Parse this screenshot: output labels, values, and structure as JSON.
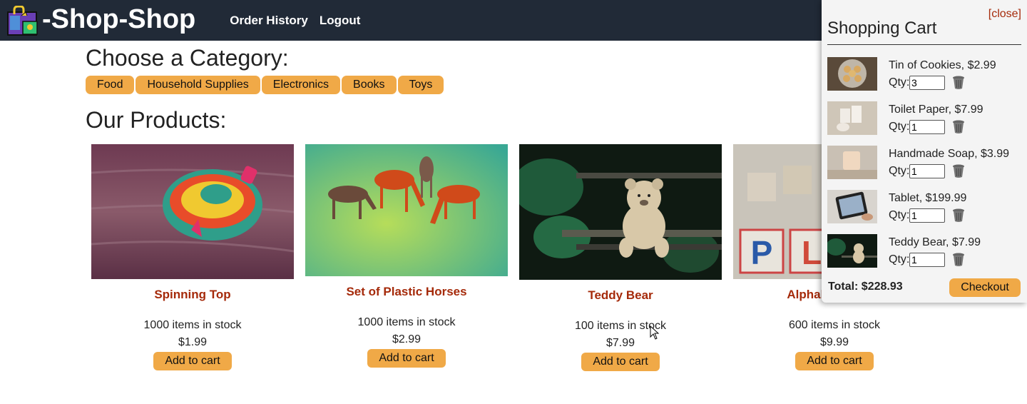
{
  "header": {
    "logo_text": "-Shop-Shop",
    "nav": [
      "Order History",
      "Logout"
    ]
  },
  "main": {
    "category_heading": "Choose a Category:",
    "categories": [
      "Food",
      "Household Supplies",
      "Electronics",
      "Books",
      "Toys"
    ],
    "products_heading": "Our Products:",
    "products": [
      {
        "name": "Spinning Top",
        "stock": "1000 items in stock",
        "price": "$1.99",
        "button": "Add to cart",
        "image": "spinning-top-photo"
      },
      {
        "name": "Set of Plastic Horses",
        "stock": "1000 items in stock",
        "price": "$2.99",
        "button": "Add to cart",
        "image": "plastic-horses-photo"
      },
      {
        "name": "Teddy Bear",
        "stock": "100 items in stock",
        "price": "$7.99",
        "button": "Add to cart",
        "image": "teddy-bear-photo"
      },
      {
        "name": "Alphabet Blocks",
        "stock": "600 items in stock",
        "price": "$9.99",
        "button": "Add to cart",
        "image": "alphabet-blocks-photo"
      }
    ]
  },
  "cart": {
    "close_label": "[close]",
    "title": "Shopping Cart",
    "items": [
      {
        "name": "Tin of Cookies, $2.99",
        "qty_label": "Qty:",
        "qty": "3",
        "image": "cookies-photo"
      },
      {
        "name": "Toilet Paper, $7.99",
        "qty_label": "Qty:",
        "qty": "1",
        "image": "toilet-paper-photo"
      },
      {
        "name": "Handmade Soap, $3.99",
        "qty_label": "Qty:",
        "qty": "1",
        "image": "soap-photo"
      },
      {
        "name": "Tablet, $199.99",
        "qty_label": "Qty:",
        "qty": "1",
        "image": "tablet-photo"
      },
      {
        "name": "Teddy Bear, $7.99",
        "qty_label": "Qty:",
        "qty": "1",
        "image": "teddy-bear-photo"
      }
    ],
    "total": "Total: $228.93",
    "checkout_label": "Checkout"
  },
  "colors": {
    "header_bg": "#212a37",
    "accent": "#f0a947",
    "product_name": "#a52a0a"
  }
}
